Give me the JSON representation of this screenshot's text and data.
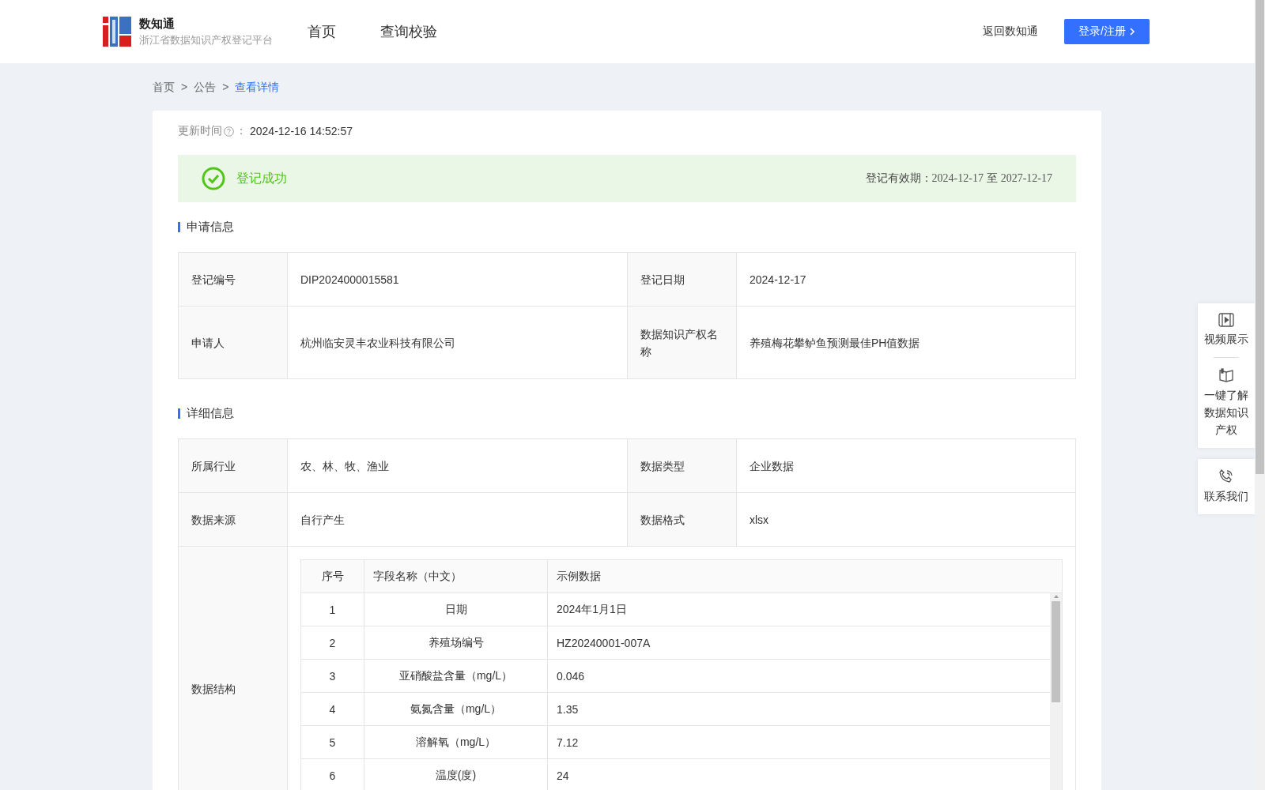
{
  "header": {
    "brand": {
      "name": "数知通",
      "subtitle": "浙江省数据知识产权登记平台"
    },
    "nav": [
      {
        "label": "首页",
        "selected": false
      },
      {
        "label": "查询校验",
        "selected": false
      }
    ],
    "back_link": "返回数知通",
    "login_button": "登录/注册"
  },
  "breadcrumb": [
    {
      "label": "首页",
      "current": false
    },
    {
      "label": "公告",
      "current": false
    },
    {
      "label": "查看详情",
      "current": true
    }
  ],
  "breadcrumb_separator": ">",
  "update_time": {
    "label": "更新时间",
    "colon": "：",
    "value": "2024-12-16 14:52:57"
  },
  "status_banner": {
    "status": "登记成功",
    "validity_label": "登记有效期：",
    "validity_from": "2024-12-17",
    "validity_sep": "至",
    "validity_to": "2027-12-17"
  },
  "application_info": {
    "title": "申请信息",
    "rows": [
      [
        {
          "label": "登记编号",
          "value": "DIP2024000015581"
        },
        {
          "label": "登记日期",
          "value": "2024-12-17"
        }
      ],
      [
        {
          "label": "申请人",
          "value": "杭州临安灵丰农业科技有限公司"
        },
        {
          "label": "数据知识产权名称",
          "value": "养殖梅花攀鲈鱼预测最佳PH值数据"
        }
      ]
    ]
  },
  "detail_info": {
    "title": "详细信息",
    "rows": [
      [
        {
          "label": "所属行业",
          "value": "农、林、牧、渔业"
        },
        {
          "label": "数据类型",
          "value": "企业数据"
        }
      ],
      [
        {
          "label": "数据来源",
          "value": "自行产生"
        },
        {
          "label": "数据格式",
          "value": "xlsx"
        }
      ]
    ],
    "structure": {
      "label": "数据结构",
      "columns": [
        "序号",
        "字段名称（中文）",
        "示例数据"
      ],
      "rows": [
        [
          "1",
          "日期",
          "2024年1月1日"
        ],
        [
          "2",
          "养殖场编号",
          "HZ20240001-007A"
        ],
        [
          "3",
          "亚硝酸盐含量（mg/L）",
          "0.046"
        ],
        [
          "4",
          "氨氮含量（mg/L）",
          "1.35"
        ],
        [
          "5",
          "溶解氧（mg/L）",
          "7.12"
        ],
        [
          "6",
          "温度(度)",
          "24"
        ]
      ]
    }
  },
  "side_panel": [
    {
      "kind": "video",
      "label": "视频展示"
    },
    {
      "kind": "book",
      "label": "一键了解数据知识产权"
    },
    {
      "kind": "phone",
      "label": "联系我们"
    }
  ]
}
